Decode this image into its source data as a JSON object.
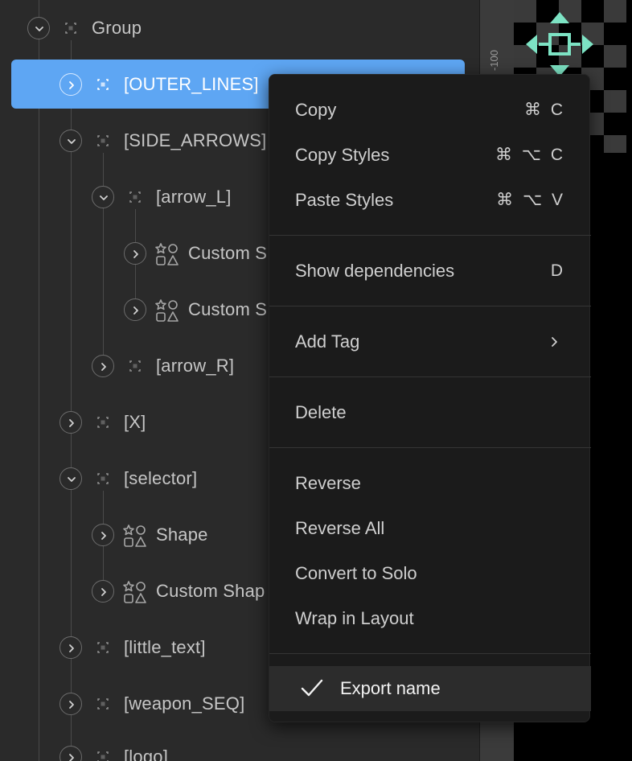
{
  "tree": {
    "items": [
      {
        "label": "Group",
        "icon": "frame-icon",
        "expanded": true
      },
      {
        "label": "[OUTER_LINES]",
        "icon": "frame-icon",
        "expanded": false,
        "selected": true
      },
      {
        "label": "[SIDE_ARROWS]",
        "icon": "frame-icon",
        "expanded": true
      },
      {
        "label": "[arrow_L]",
        "icon": "frame-icon",
        "expanded": true
      },
      {
        "label": "Custom S",
        "icon": "shapes-icon",
        "expanded": false
      },
      {
        "label": "Custom S",
        "icon": "shapes-icon",
        "expanded": false
      },
      {
        "label": "[arrow_R]",
        "icon": "frame-icon",
        "expanded": false
      },
      {
        "label": "[X]",
        "icon": "frame-icon",
        "expanded": false
      },
      {
        "label": "[selector]",
        "icon": "frame-icon",
        "expanded": true
      },
      {
        "label": "Shape",
        "icon": "shapes-icon",
        "expanded": false
      },
      {
        "label": "Custom Shap",
        "icon": "shapes-icon",
        "expanded": false
      },
      {
        "label": "[little_text]",
        "icon": "frame-icon",
        "expanded": false
      },
      {
        "label": "[weapon_SEQ]",
        "icon": "frame-icon",
        "expanded": false
      },
      {
        "label": "[logo]",
        "icon": "frame-icon",
        "expanded": false
      }
    ]
  },
  "ruler": {
    "tick_label": "-100"
  },
  "canvas": {
    "icon": "move-arrows-icon",
    "accent": "#7de3c4"
  },
  "context_menu": {
    "items": [
      {
        "label": "Copy",
        "shortcut": "⌘ C"
      },
      {
        "label": "Copy Styles",
        "shortcut": "⌘ ⌥ C"
      },
      {
        "label": "Paste Styles",
        "shortcut": "⌘ ⌥ V"
      },
      {
        "label": "Show dependencies",
        "shortcut": "D"
      },
      {
        "label": "Add Tag",
        "submenu_icon": "chevron-right-icon"
      },
      {
        "label": "Delete"
      },
      {
        "label": "Reverse"
      },
      {
        "label": "Reverse All"
      },
      {
        "label": "Convert to Solo"
      },
      {
        "label": "Wrap in Layout"
      },
      {
        "label": "Export name",
        "checked": true,
        "check_icon": "checkmark-icon"
      }
    ]
  },
  "colors": {
    "selection": "#5ea6f3",
    "panel_bg": "#2a2a2a",
    "menu_bg": "#1b1b1b",
    "text": "#c6c6c6"
  }
}
